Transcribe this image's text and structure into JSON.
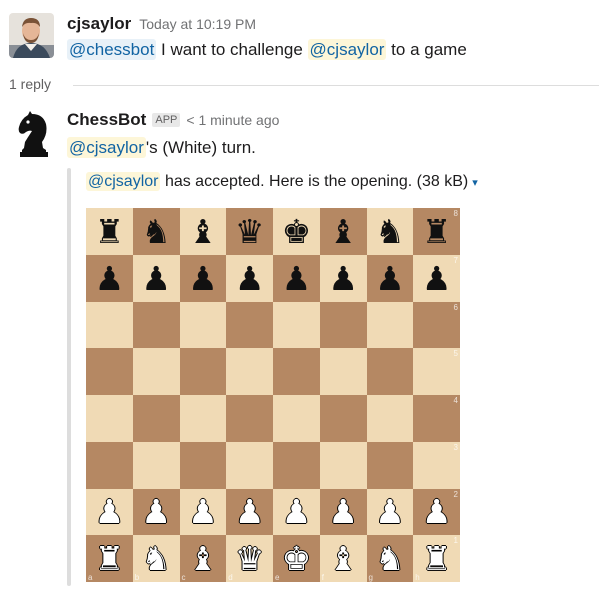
{
  "message1": {
    "username": "cjsaylor",
    "timestamp": "Today at 10:19 PM",
    "mention_chessbot": "@chessbot",
    "text_middle": "I want to challenge",
    "mention_user": "@cjsaylor",
    "text_end": "to a game"
  },
  "thread": {
    "replies_label": "1 reply"
  },
  "message2": {
    "username": "ChessBot",
    "badge": "APP",
    "timestamp": "< 1 minute ago",
    "mention_user": "@cjsaylor",
    "turn_text": "'s (White) turn.",
    "attachment": {
      "mention_user": "@cjsaylor",
      "title_text": "has accepted. Here is the opening.",
      "size": "(38 kB)",
      "caret": "▾"
    }
  },
  "board": {
    "ranks": [
      {
        "label": "8",
        "pieces": [
          "♜",
          "♞",
          "♝",
          "♛",
          "♚",
          "♝",
          "♞",
          "♜"
        ],
        "color": "black"
      },
      {
        "label": "7",
        "pieces": [
          "♟",
          "♟",
          "♟",
          "♟",
          "♟",
          "♟",
          "♟",
          "♟"
        ],
        "color": "black"
      },
      {
        "label": "6",
        "pieces": [
          "",
          "",
          "",
          "",
          "",
          "",
          "",
          ""
        ],
        "color": ""
      },
      {
        "label": "5",
        "pieces": [
          "",
          "",
          "",
          "",
          "",
          "",
          "",
          ""
        ],
        "color": ""
      },
      {
        "label": "4",
        "pieces": [
          "",
          "",
          "",
          "",
          "",
          "",
          "",
          ""
        ],
        "color": ""
      },
      {
        "label": "3",
        "pieces": [
          "",
          "",
          "",
          "",
          "",
          "",
          "",
          ""
        ],
        "color": ""
      },
      {
        "label": "2",
        "pieces": [
          "♟",
          "♟",
          "♟",
          "♟",
          "♟",
          "♟",
          "♟",
          "♟"
        ],
        "color": "white"
      },
      {
        "label": "1",
        "pieces": [
          "♜",
          "♞",
          "♝",
          "♛",
          "♚",
          "♝",
          "♞",
          "♜"
        ],
        "color": "white"
      }
    ],
    "files": [
      "a",
      "b",
      "c",
      "d",
      "e",
      "f",
      "g",
      "h"
    ],
    "light_color": "#f0dab5",
    "dark_color": "#b58863"
  }
}
